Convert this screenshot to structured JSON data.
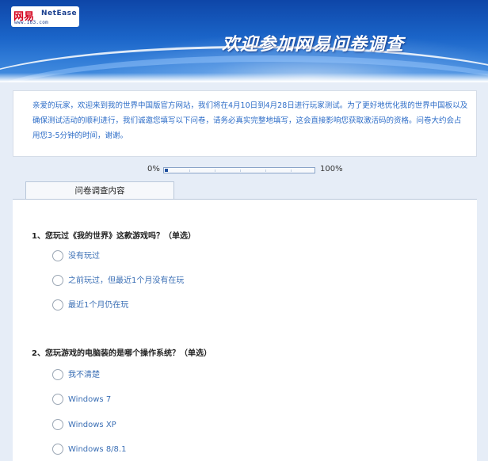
{
  "header": {
    "logo_cn": "网易",
    "logo_en": "NetEase",
    "logo_url": "www.163.com",
    "title": "欢迎参加网易问卷调查"
  },
  "intro": {
    "text": "亲爱的玩家，欢迎来到我的世界中国版官方网站，我们将在4月10日到4月28日进行玩家测试。为了更好地优化我的世界中国板以及确保测试活动的顺利进行，我们诚邀您填写以下问卷，请务必真实完整地填写，这会直接影响您获取激活码的资格。问卷大约会占用您3-5分钟的时间，谢谢。"
  },
  "progress": {
    "left_label": "0%",
    "right_label": "100%",
    "value": 0.02
  },
  "tab": {
    "label": "问卷调查内容"
  },
  "questions": [
    {
      "title": "1、您玩过《我的世界》这款游戏吗？（单选）",
      "options": [
        "没有玩过",
        "之前玩过，但最近1个月没有在玩",
        "最近1个月仍在玩"
      ]
    },
    {
      "title": "2、您玩游戏的电脑装的是哪个操作系统？（单选）",
      "options": [
        "我不清楚",
        "Windows 7",
        "Windows XP",
        "Windows 8/8.1"
      ]
    }
  ],
  "colors": {
    "banner": "#1a64c8",
    "accent_text": "#2c6cc7",
    "progress_fill": "#1d4f9e"
  }
}
